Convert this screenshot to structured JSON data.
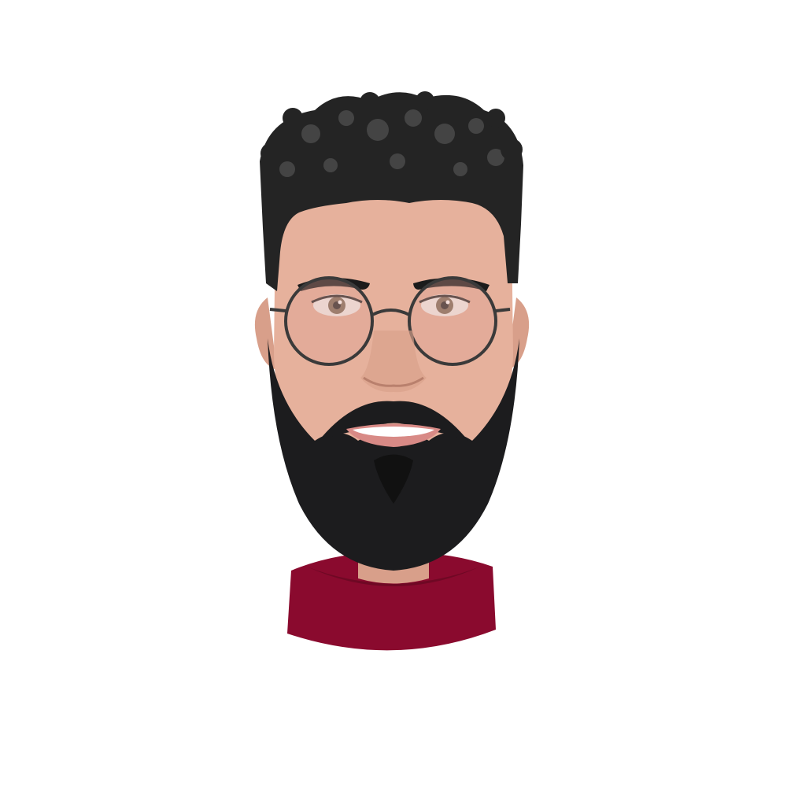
{
  "image": {
    "subject": "cartoon-avatar",
    "alt_text": "",
    "colors": {
      "background": "#ffffff",
      "hair": "#242424",
      "hair_highlight": "#4a4a4a",
      "skin": "#e6b19c",
      "skin_shadow": "#d89f8a",
      "beard": "#1c1c1e",
      "lips": "#d88a86",
      "teeth": "#ffffff",
      "eye_iris": "#7d6c5a",
      "eye_white": "#f4f1ef",
      "glasses_frame": "#3a3a3a",
      "glasses_lens": "rgba(220,160,150,0.35)",
      "shirt": "#8a0a2e",
      "shirt_collar_shadow": "#6f0824",
      "eyebrow": "#1b1b1b"
    }
  }
}
